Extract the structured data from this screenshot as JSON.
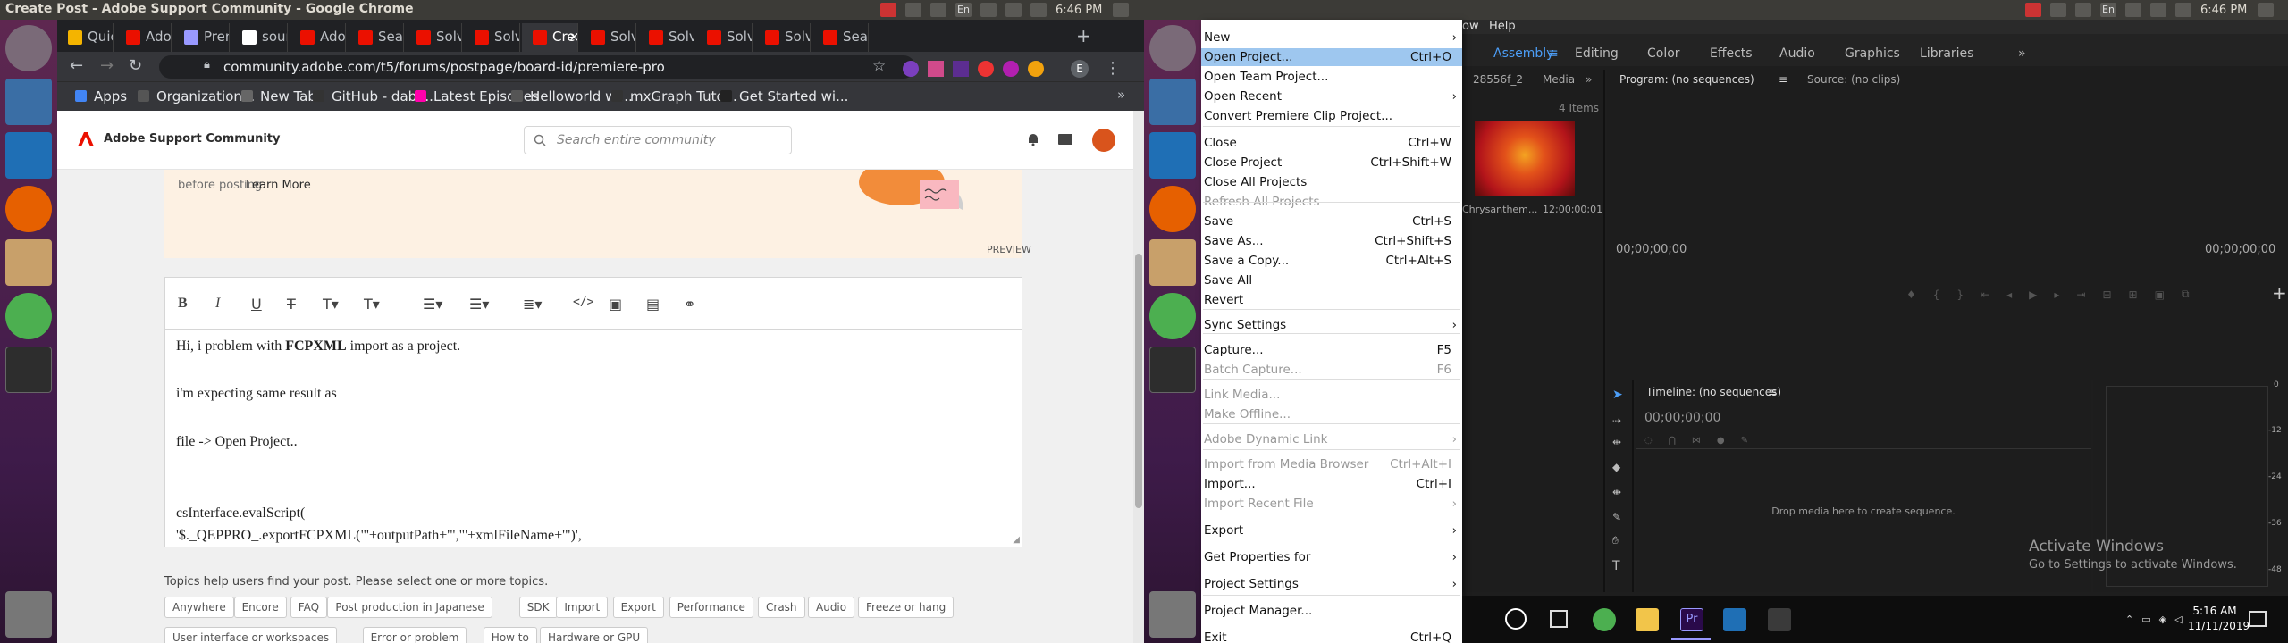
{
  "topbar": {
    "window_title": "Create Post - Adobe Support Community - Google Chrome",
    "left_time": "6:46 PM",
    "right_time": "6:46 PM",
    "lang": "En"
  },
  "chrome": {
    "tabs": [
      "Quick",
      "Adob",
      "Prem",
      "sourc",
      "Adob",
      "Searc",
      "Solve",
      "Solve",
      "Cre",
      "Solve",
      "Solve",
      "Solve",
      "Solve",
      "Searc"
    ],
    "url": "community.adobe.com/t5/forums/postpage/board-id/premiere-pro",
    "profile_letter": "E",
    "bookmarks": [
      "Apps",
      "Organization...",
      "New Tab",
      "GitHub - dabe...",
      "Latest Episodes",
      "Helloworld wi...",
      "mxGraph Tuto...",
      "Get Started wi..."
    ]
  },
  "site": {
    "brand": "Adobe Support Community",
    "search_placeholder": "Search entire community",
    "banner_text": "before posting.",
    "banner_link": "Learn More",
    "preview_label": "PREVIEW",
    "editor_lines": [
      "Hi, i problem with",
      "FCPXML",
      "import as a project.",
      "i'm expecting same result as",
      "file -> Open Project..",
      "csInterface.evalScript(",
      "'$._QEPPRO_.exportFCPXML(\"'+outputPath+'\",\"'+xmlFileName+'\")',"
    ],
    "topics_help": "Topics help users find your post. Please select one or more topics.",
    "tags_row1": [
      "Anywhere",
      "Encore",
      "FAQ",
      "Post production in Japanese",
      "SDK",
      "Import",
      "Export",
      "Performance",
      "Crash",
      "Audio",
      "Freeze or hang"
    ],
    "tags_row2": [
      "User interface or workspaces",
      "Error or problem",
      "How to",
      "Hardware or GPU"
    ]
  },
  "premiere": {
    "menubar": [
      "ow",
      "Help"
    ],
    "workspaces": [
      "Assembly",
      "Editing",
      "Color",
      "Effects",
      "Audio",
      "Graphics",
      "Libraries"
    ],
    "project_tab": "28556f_2",
    "media_tab": "Media",
    "items_count": "4 Items",
    "clip_name": "Chrysanthem...",
    "clip_duration": "12;00;00;01",
    "program_tab": "Program: (no sequences)",
    "source_tab": "Source: (no clips)",
    "program_tc_left": "00;00;00;00",
    "program_tc_right": "00;00;00;00",
    "timeline_tab": "Timeline: (no sequences)",
    "timeline_tc": "00;00;00;00",
    "drop_text": "Drop media here to create sequence.",
    "meter_labels": [
      "0",
      "-12",
      "-24",
      "-36",
      "-48"
    ],
    "activate_title": "Activate Windows",
    "activate_sub": "Go to Settings to activate Windows.",
    "menu_items": [
      {
        "label": "New",
        "shortcut": "",
        "arrow": true,
        "disabled": false
      },
      {
        "label": "Open Project...",
        "shortcut": "Ctrl+O",
        "arrow": false,
        "disabled": false
      },
      {
        "label": "Open Team Project...",
        "shortcut": "",
        "arrow": false,
        "disabled": false
      },
      {
        "label": "Open Recent",
        "shortcut": "",
        "arrow": true,
        "disabled": false
      },
      {
        "label": "Convert Premiere Clip Project...",
        "shortcut": "",
        "arrow": false,
        "disabled": false
      },
      {
        "label": "Close",
        "shortcut": "Ctrl+W",
        "arrow": false,
        "disabled": false
      },
      {
        "label": "Close Project",
        "shortcut": "Ctrl+Shift+W",
        "arrow": false,
        "disabled": false
      },
      {
        "label": "Close All Projects",
        "shortcut": "",
        "arrow": false,
        "disabled": false
      },
      {
        "label": "Refresh All Projects",
        "shortcut": "",
        "arrow": false,
        "disabled": true
      },
      {
        "label": "Save",
        "shortcut": "Ctrl+S",
        "arrow": false,
        "disabled": false
      },
      {
        "label": "Save As...",
        "shortcut": "Ctrl+Shift+S",
        "arrow": false,
        "disabled": false
      },
      {
        "label": "Save a Copy...",
        "shortcut": "Ctrl+Alt+S",
        "arrow": false,
        "disabled": false
      },
      {
        "label": "Save All",
        "shortcut": "",
        "arrow": false,
        "disabled": false
      },
      {
        "label": "Revert",
        "shortcut": "",
        "arrow": false,
        "disabled": false
      },
      {
        "label": "Sync Settings",
        "shortcut": "",
        "arrow": true,
        "disabled": false
      },
      {
        "label": "Capture...",
        "shortcut": "F5",
        "arrow": false,
        "disabled": false
      },
      {
        "label": "Batch Capture...",
        "shortcut": "F6",
        "arrow": false,
        "disabled": true
      },
      {
        "label": "Link Media...",
        "shortcut": "",
        "arrow": false,
        "disabled": true
      },
      {
        "label": "Make Offline...",
        "shortcut": "",
        "arrow": false,
        "disabled": true
      },
      {
        "label": "Adobe Dynamic Link",
        "shortcut": "",
        "arrow": true,
        "disabled": true
      },
      {
        "label": "Import from Media Browser",
        "shortcut": "Ctrl+Alt+I",
        "arrow": false,
        "disabled": true
      },
      {
        "label": "Import...",
        "shortcut": "Ctrl+I",
        "arrow": false,
        "disabled": false
      },
      {
        "label": "Import Recent File",
        "shortcut": "",
        "arrow": true,
        "disabled": true
      },
      {
        "label": "Export",
        "shortcut": "",
        "arrow": true,
        "disabled": false
      },
      {
        "label": "Get Properties for",
        "shortcut": "",
        "arrow": true,
        "disabled": false
      },
      {
        "label": "Project Settings",
        "shortcut": "",
        "arrow": true,
        "disabled": false
      },
      {
        "label": "Project Manager...",
        "shortcut": "",
        "arrow": false,
        "disabled": false
      },
      {
        "label": "Exit",
        "shortcut": "Ctrl+Q",
        "arrow": false,
        "disabled": false
      }
    ]
  },
  "taskbar": {
    "time": "5:16 AM",
    "date": "11/11/2019"
  },
  "colors": {
    "menu_highlight": "#9ec7ef",
    "adobe_red": "#eb1000",
    "premiere_blue": "#9999ff",
    "ubuntu_orange": "#e95420"
  }
}
